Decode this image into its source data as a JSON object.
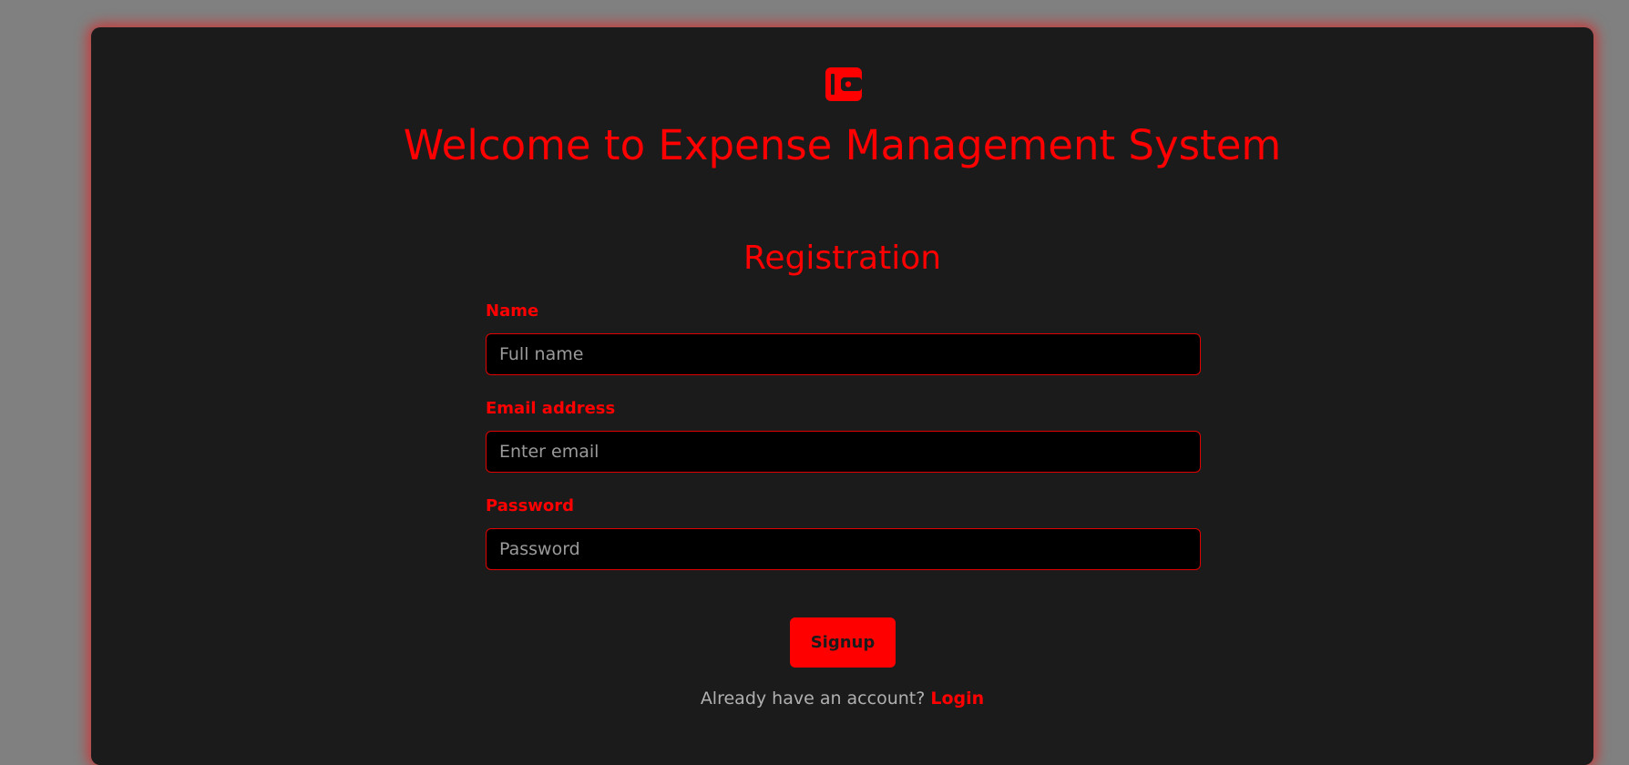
{
  "colors": {
    "accent": "#ff0000",
    "card_background": "#1b1b1c",
    "page_background": "#808080",
    "input_background": "#000000",
    "muted_text": "#b0b0b0"
  },
  "header": {
    "logo_icon": "wallet-icon",
    "title": "Welcome to Expense Management System"
  },
  "form": {
    "title": "Registration",
    "fields": {
      "name": {
        "label": "Name",
        "placeholder": "Full name",
        "value": ""
      },
      "email": {
        "label": "Email address",
        "placeholder": "Enter email",
        "value": ""
      },
      "password": {
        "label": "Password",
        "placeholder": "Password",
        "value": ""
      }
    },
    "submit_label": "Signup",
    "account_prompt": "Already have an account?",
    "login_label": "Login"
  }
}
